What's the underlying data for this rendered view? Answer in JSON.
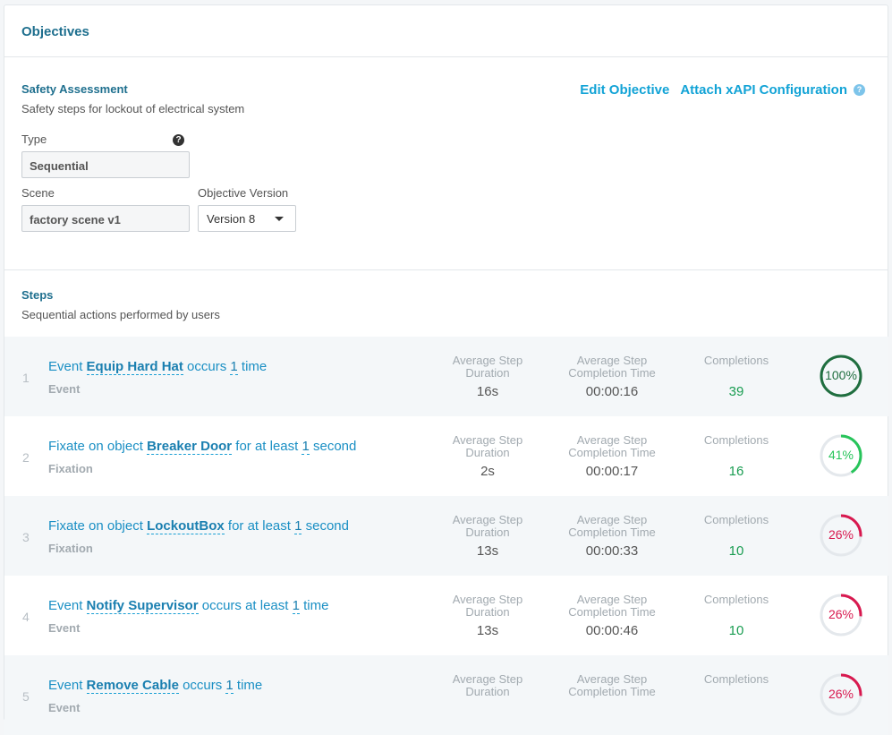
{
  "header": {
    "title": "Objectives"
  },
  "objective": {
    "name": "Safety Assessment",
    "description": "Safety steps for lockout of electrical system",
    "edit_label": "Edit Objective",
    "attach_label": "Attach xAPI Configuration",
    "attach_help": "?",
    "type_label": "Type",
    "type_help": "?",
    "type_value": "Sequential",
    "scene_label": "Scene",
    "scene_value": "factory scene v1",
    "version_label": "Objective Version",
    "version_value": "Version 8"
  },
  "steps_section": {
    "title": "Steps",
    "subtitle": "Sequential actions performed by users"
  },
  "metric_labels": {
    "avg_duration_1": "Average Step",
    "avg_duration_2": "Duration",
    "avg_completion_1": "Average Step",
    "avg_completion_2": "Completion Time",
    "completions": "Completions"
  },
  "colors": {
    "high": "#1f6e3f",
    "medium": "#27c45a",
    "low": "#d8194f",
    "track": "#e4e8ec"
  },
  "steps": [
    {
      "num": "1",
      "pre": "Event ",
      "target": "Equip Hard Hat",
      "mid": " occurs ",
      "count": "1",
      "post": " time",
      "kind": "Event",
      "avg_duration": "16s",
      "avg_completion": "00:00:16",
      "completions": "39",
      "percent_label": "100%",
      "percent": 100,
      "level": "high"
    },
    {
      "num": "2",
      "pre": "Fixate on object ",
      "target": "Breaker Door",
      "mid": " for at least ",
      "count": "1",
      "post": " second",
      "kind": "Fixation",
      "avg_duration": "2s",
      "avg_completion": "00:00:17",
      "completions": "16",
      "percent_label": "41%",
      "percent": 41,
      "level": "medium"
    },
    {
      "num": "3",
      "pre": "Fixate on object ",
      "target": "LockoutBox",
      "mid": " for at least ",
      "count": "1",
      "post": " second",
      "kind": "Fixation",
      "avg_duration": "13s",
      "avg_completion": "00:00:33",
      "completions": "10",
      "percent_label": "26%",
      "percent": 26,
      "level": "low"
    },
    {
      "num": "4",
      "pre": "Event ",
      "target": "Notify Supervisor",
      "mid": " occurs at least ",
      "count": "1",
      "post": " time",
      "kind": "Event",
      "avg_duration": "13s",
      "avg_completion": "00:00:46",
      "completions": "10",
      "percent_label": "26%",
      "percent": 26,
      "level": "low"
    },
    {
      "num": "5",
      "pre": "Event ",
      "target": "Remove Cable",
      "mid": " occurs ",
      "count": "1",
      "post": " time",
      "kind": "Event",
      "avg_duration": "",
      "avg_completion": "",
      "completions": "",
      "percent_label": "26%",
      "percent": 26,
      "level": "low"
    }
  ]
}
